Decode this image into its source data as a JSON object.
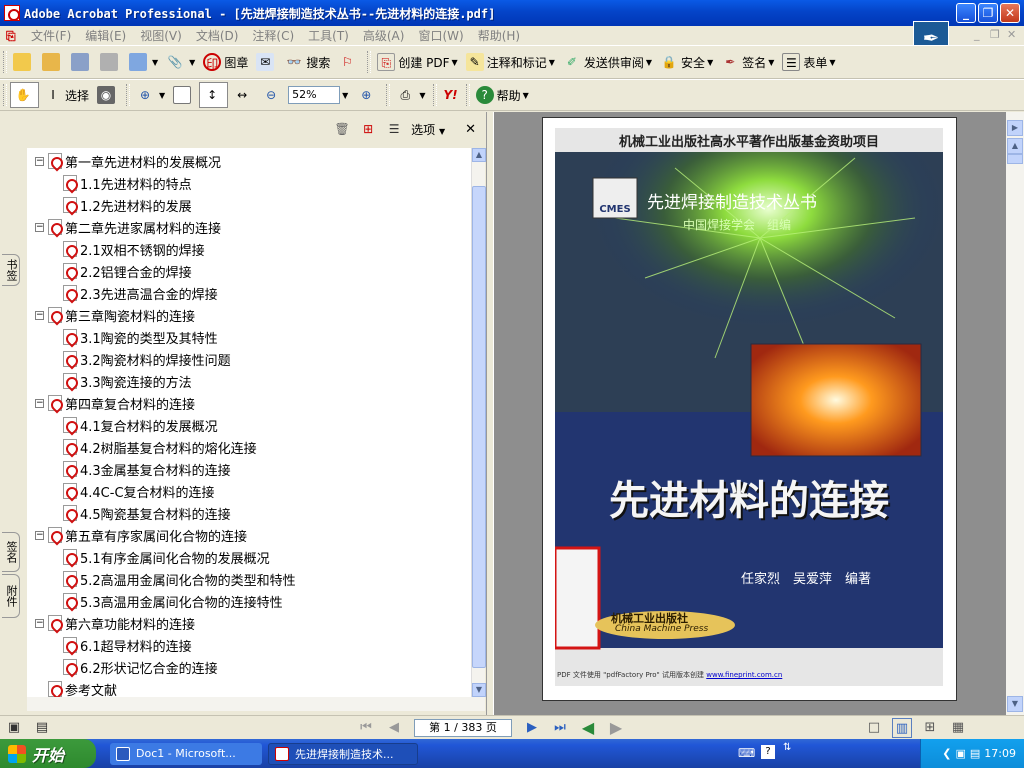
{
  "window": {
    "title": "Adobe Acrobat Professional - [先进焊接制造技术丛书--先进材料的连接.pdf]",
    "controls": {
      "minimize": "_",
      "restore": "❐",
      "close": "✕"
    },
    "mdi_controls": [
      "_",
      "❐",
      "✕"
    ]
  },
  "menubar": {
    "items": [
      "文件(F)",
      "编辑(E)",
      "视图(V)",
      "文档(D)",
      "注释(C)",
      "工具(T)",
      "高级(A)",
      "窗口(W)",
      "帮助(H)"
    ]
  },
  "toolbar1": {
    "stamp_label": "图章",
    "search_label": "搜索",
    "create_pdf_label": "创建 PDF",
    "comment_label": "注释和标记",
    "review_label": "发送供审阅",
    "security_label": "安全",
    "sign_label": "签名",
    "forms_label": "表单"
  },
  "toolbar2": {
    "select_label": "选择",
    "zoom_value": "52%",
    "help_label": "帮助",
    "yahoo_label": "Y!"
  },
  "nav_pane": {
    "header": {
      "options_label": "选项",
      "close": "✕"
    },
    "tabs": [
      "书签",
      "签名",
      "附件"
    ],
    "bookmarks": [
      {
        "label": "第一章先进材料的发展概况",
        "level": 0,
        "expanded": true
      },
      {
        "label": "1.1先进材料的特点",
        "level": 1
      },
      {
        "label": "1.2先进材料的发展",
        "level": 1
      },
      {
        "label": "第二章先进家属材料的连接",
        "level": 0,
        "expanded": true
      },
      {
        "label": "2.1双相不锈钢的焊接",
        "level": 1
      },
      {
        "label": "2.2铝锂合金的焊接",
        "level": 1
      },
      {
        "label": "2.3先进高温合金的焊接",
        "level": 1
      },
      {
        "label": "第三章陶瓷材料的连接",
        "level": 0,
        "expanded": true
      },
      {
        "label": "3.1陶瓷的类型及其特性",
        "level": 1
      },
      {
        "label": "3.2陶瓷材料的焊接性问题",
        "level": 1
      },
      {
        "label": "3.3陶瓷连接的方法",
        "level": 1
      },
      {
        "label": "第四章复合材料的连接",
        "level": 0,
        "expanded": true
      },
      {
        "label": "4.1复合材料的发展概况",
        "level": 1
      },
      {
        "label": "4.2树脂基复合材料的熔化连接",
        "level": 1
      },
      {
        "label": "4.3金属基复合材料的连接",
        "level": 1
      },
      {
        "label": "4.4C-C复合材料的连接",
        "level": 1
      },
      {
        "label": "4.5陶瓷基复合材料的连接",
        "level": 1
      },
      {
        "label": "第五章有序家属间化合物的连接",
        "level": 0,
        "expanded": true
      },
      {
        "label": "5.1有序金属间化合物的发展概况",
        "level": 1
      },
      {
        "label": "5.2高温用金属间化合物的类型和特性",
        "level": 1
      },
      {
        "label": "5.3高温用金属间化合物的连接特性",
        "level": 1
      },
      {
        "label": "第六章功能材料的连接",
        "level": 0,
        "expanded": true
      },
      {
        "label": "6.1超导材料的连接",
        "level": 1
      },
      {
        "label": "6.2形状记忆合金的连接",
        "level": 1
      },
      {
        "label": "参考文献",
        "level": 0
      }
    ]
  },
  "cover": {
    "top_banner": "机械工业出版社高水平著作出版基金资助项目",
    "logo_text": "CMES",
    "series_title": "先进焊接制造技术丛书",
    "organizer": "中国焊接学会　组编",
    "book_title": "先进材料的连接",
    "authors": "任家烈　吴爱萍　编著",
    "publisher_logo": "机械工业出版社",
    "publisher_en": "China Machine Press",
    "footer_text": "PDF 文件使用 \"pdfFactory Pro\" 试用版本创建",
    "footer_link": "www.fineprint.com.cn",
    "colors": {
      "background": "#223570",
      "title": "#f5f5f5",
      "accent_red": "#d41414",
      "green_glow": "#7ed23a"
    }
  },
  "statusbar": {
    "page_display": "第 1 / 383 页"
  },
  "taskbar": {
    "start_label": "开始",
    "tasks": [
      "Doc1 - Microsoft...",
      "先进焊接制造技术..."
    ],
    "clock": "17:09"
  }
}
